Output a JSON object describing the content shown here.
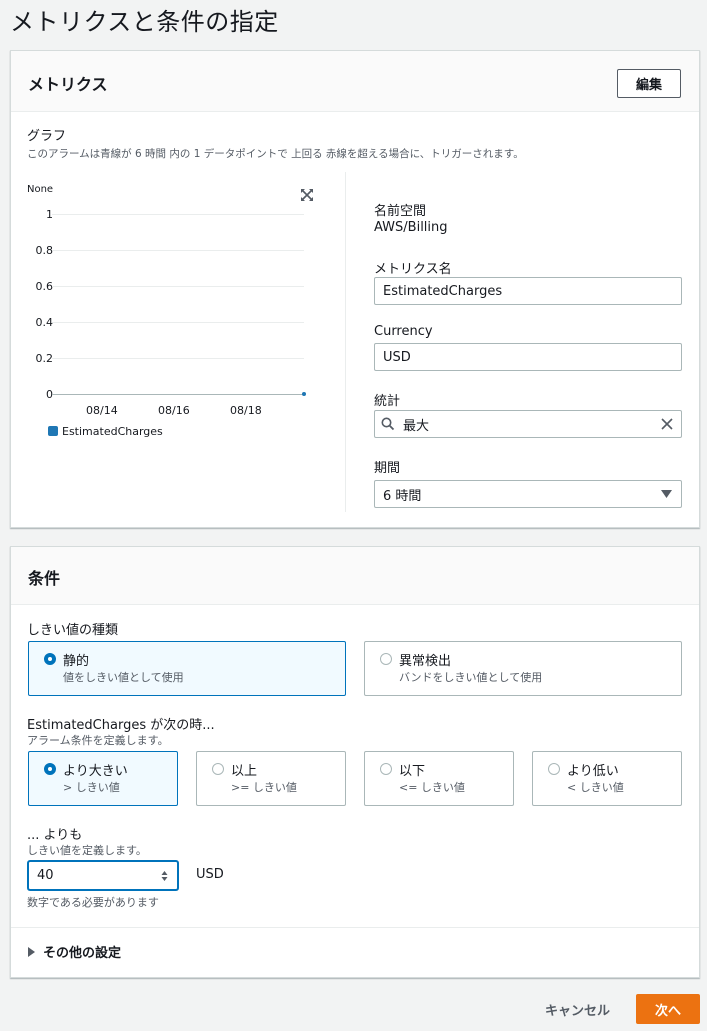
{
  "page_title": "メトリクスと条件の指定",
  "metrics": {
    "title": "メトリクス",
    "edit_label": "編集",
    "graph_label": "グラフ",
    "graph_desc": "このアラームは青線が 6 時間 内の 1 データポイントで 上回る 赤線を超える場合に、トリガーされます。",
    "namespace_label": "名前空間",
    "namespace_value": "AWS/Billing",
    "metric_name_label": "メトリクス名",
    "metric_name_value": "EstimatedCharges",
    "currency_label": "Currency",
    "currency_value": "USD",
    "statistic_label": "統計",
    "statistic_value": "最大",
    "period_label": "期間",
    "period_value": "6 時間",
    "icons": [
      "expand-icon",
      "search-icon",
      "clear-icon",
      "caret-down-icon"
    ]
  },
  "chart_data": {
    "type": "line",
    "ylabel": "None",
    "ylim": [
      0,
      1
    ],
    "y_ticks": [
      "1",
      "0.8",
      "0.6",
      "0.4",
      "0.2",
      "0"
    ],
    "x_ticks": [
      "08/14",
      "08/16",
      "08/18"
    ],
    "series": [
      {
        "name": "EstimatedCharges",
        "color": "#1f77b4",
        "points": [
          {
            "x": "08/20",
            "y": 0
          }
        ]
      }
    ]
  },
  "conditions": {
    "title": "条件",
    "threshold_type_label": "しきい値の種類",
    "threshold_types": [
      {
        "title": "静的",
        "desc": "値をしきい値として使用",
        "selected": true
      },
      {
        "title": "異常検出",
        "desc": "バンドをしきい値として使用",
        "selected": false
      }
    ],
    "when_label": "EstimatedCharges が次の時...",
    "when_desc": "アラーム条件を定義します。",
    "operators": [
      {
        "title": "より大きい",
        "desc": "> しきい値",
        "selected": true
      },
      {
        "title": "以上",
        "desc": ">= しきい値",
        "selected": false
      },
      {
        "title": "以下",
        "desc": "<= しきい値",
        "selected": false
      },
      {
        "title": "より低い",
        "desc": "< しきい値",
        "selected": false
      }
    ],
    "than_label": "... よりも",
    "than_desc": "しきい値を定義します。",
    "threshold_value": "40",
    "unit": "USD",
    "hint": "数字である必要があります",
    "additional_settings": "その他の設定"
  },
  "footer": {
    "cancel_label": "キャンセル",
    "next_label": "次へ"
  },
  "colors": {
    "accent": "#0073bb",
    "primary_button": "#ec7211"
  }
}
